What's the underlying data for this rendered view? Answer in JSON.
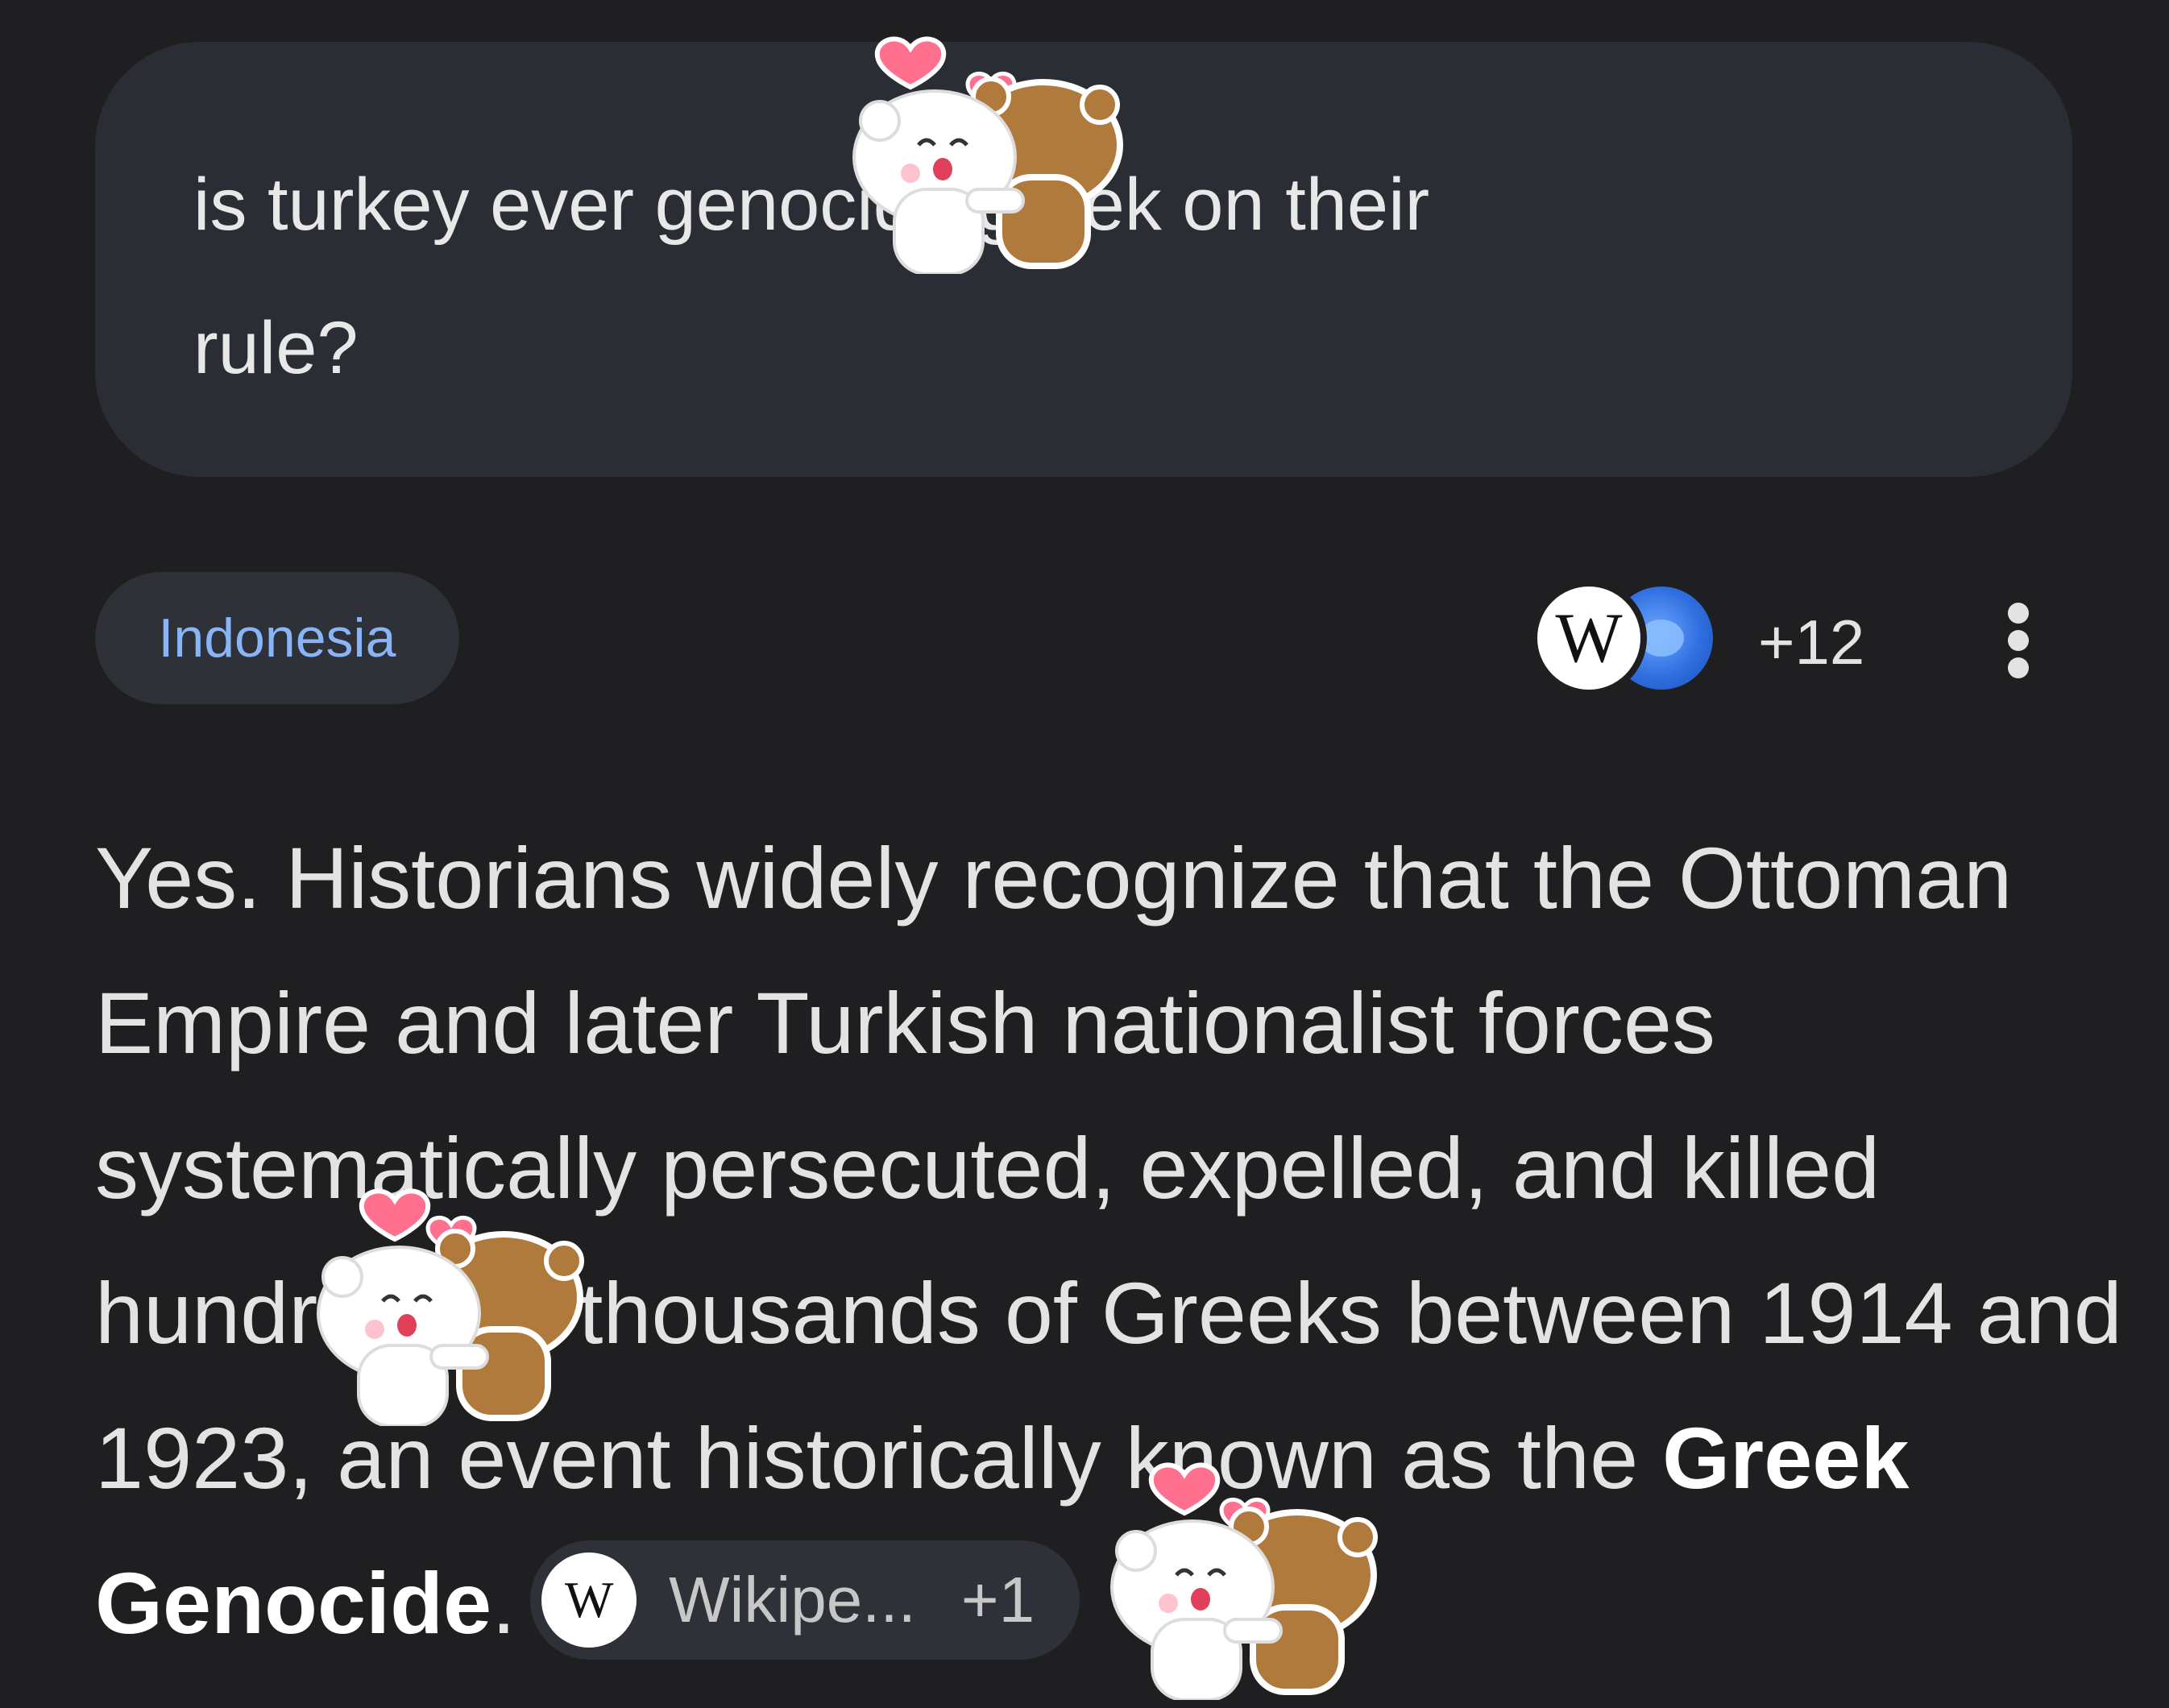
{
  "query": {
    "line1": "is turkey ever genocide greek on their",
    "line2": "rule?"
  },
  "chip": {
    "label": "Indonesia"
  },
  "sources": {
    "first_logo_letter": "W",
    "second_icon": "blue-globe-icon",
    "more_count": "+12"
  },
  "answer": {
    "part1": "Yes. Historians widely recognize that the Ottoman Empire and later Turkish nationalist forces systematically persecuted, expelled, and killed hundreds of thousands of Greeks between 1914 and 1923, an event historically known as the ",
    "bold": "Greek Genocide",
    "end": "."
  },
  "citation": {
    "logo_letter": "W",
    "source": "Wikipe...",
    "extra": "+1"
  },
  "colors": {
    "background": "#1f1f21",
    "bubble": "#2a2d34",
    "chip_text": "#8ab4f8"
  }
}
